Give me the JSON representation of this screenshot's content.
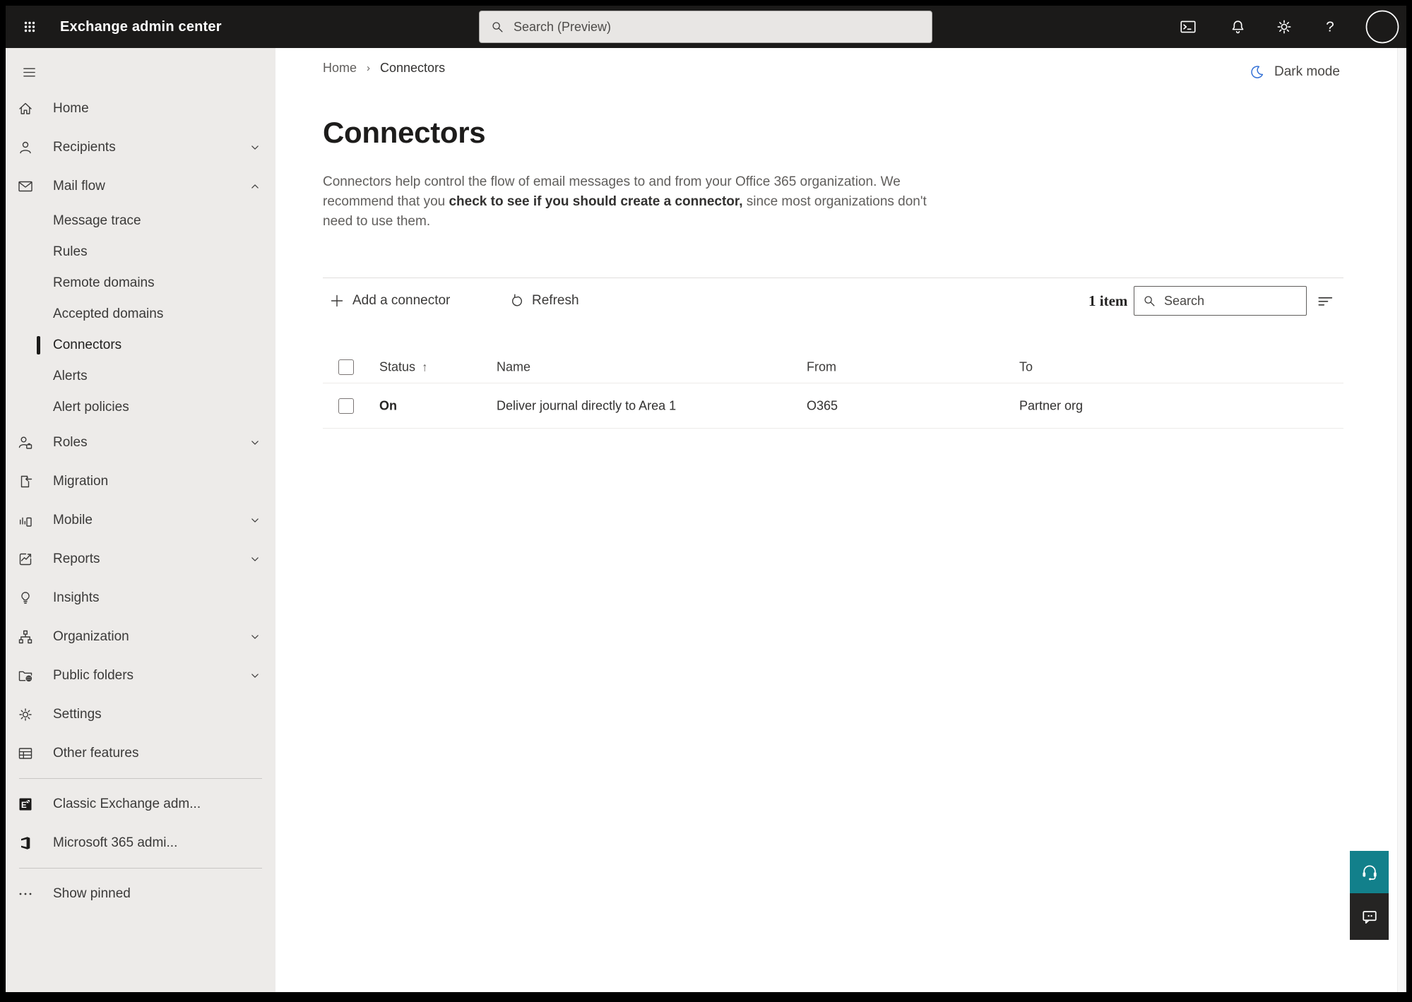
{
  "colors": {
    "topbar_bg": "#1b1a19",
    "sidebar_bg": "#edebe9",
    "moon_blue": "#3471d6",
    "help_teal": "#12808b",
    "feedback_dark": "#252423",
    "text_primary": "#323130",
    "text_secondary": "#605e5c"
  },
  "topbar": {
    "title": "Exchange admin center",
    "search_placeholder": "Search (Preview)",
    "icons": [
      "app-launcher",
      "terminal",
      "notifications",
      "settings",
      "help",
      "account"
    ]
  },
  "sidebar": {
    "hamburger_icon": "hamburger",
    "items": [
      {
        "label": "Home",
        "icon": "home",
        "type": "top"
      },
      {
        "label": "Recipients",
        "icon": "person",
        "type": "top",
        "chevron": "down"
      },
      {
        "label": "Mail flow",
        "icon": "mail",
        "type": "top",
        "chevron": "up"
      },
      {
        "label": "Message trace",
        "type": "sub"
      },
      {
        "label": "Rules",
        "type": "sub"
      },
      {
        "label": "Remote domains",
        "type": "sub"
      },
      {
        "label": "Accepted domains",
        "type": "sub"
      },
      {
        "label": "Connectors",
        "type": "sub",
        "selected": true
      },
      {
        "label": "Alerts",
        "type": "sub"
      },
      {
        "label": "Alert policies",
        "type": "sub"
      },
      {
        "label": "Roles",
        "icon": "person-badge",
        "type": "top",
        "chevron": "down"
      },
      {
        "label": "Migration",
        "icon": "migration",
        "type": "top"
      },
      {
        "label": "Mobile",
        "icon": "mobile",
        "type": "top",
        "chevron": "down"
      },
      {
        "label": "Reports",
        "icon": "reports",
        "type": "top",
        "chevron": "down"
      },
      {
        "label": "Insights",
        "icon": "lightbulb",
        "type": "top"
      },
      {
        "label": "Organization",
        "icon": "org-chart",
        "type": "top",
        "chevron": "down"
      },
      {
        "label": "Public folders",
        "icon": "folder-globe",
        "type": "top",
        "chevron": "down"
      },
      {
        "label": "Settings",
        "icon": "gear",
        "type": "top"
      },
      {
        "label": "Other features",
        "icon": "table",
        "type": "top"
      },
      {
        "type": "divider"
      },
      {
        "label": "Classic Exchange adm...",
        "icon": "exchange-logo",
        "type": "top"
      },
      {
        "label": "Microsoft 365 admi...",
        "icon": "office-logo",
        "type": "top"
      },
      {
        "type": "divider"
      },
      {
        "label": "Show pinned",
        "icon": "ellipsis",
        "type": "top"
      }
    ]
  },
  "main": {
    "breadcrumb": {
      "home": "Home",
      "current": "Connectors"
    },
    "dark_mode_label": "Dark mode",
    "title": "Connectors",
    "description": {
      "pre": "Connectors help control the flow of email messages to and from your Office 365 organization. We recommend that you ",
      "emphasis": "check to see if you should create a connector,",
      "post": " since most organizations don't need to use them."
    },
    "toolbar": {
      "add_label": "Add a connector",
      "refresh_label": "Refresh",
      "item_count": "1 item",
      "search_placeholder": "Search",
      "filter_icon": "filter"
    },
    "table": {
      "columns": [
        "Status",
        "Name",
        "From",
        "To"
      ],
      "sorted_column": "Status",
      "sort_direction": "ascending",
      "rows": [
        {
          "status": "On",
          "name": "Deliver journal directly to Area 1",
          "from": "O365",
          "to": "Partner org"
        }
      ]
    }
  },
  "floating": {
    "help_icon": "headset",
    "feedback_icon": "chat-bubble"
  }
}
